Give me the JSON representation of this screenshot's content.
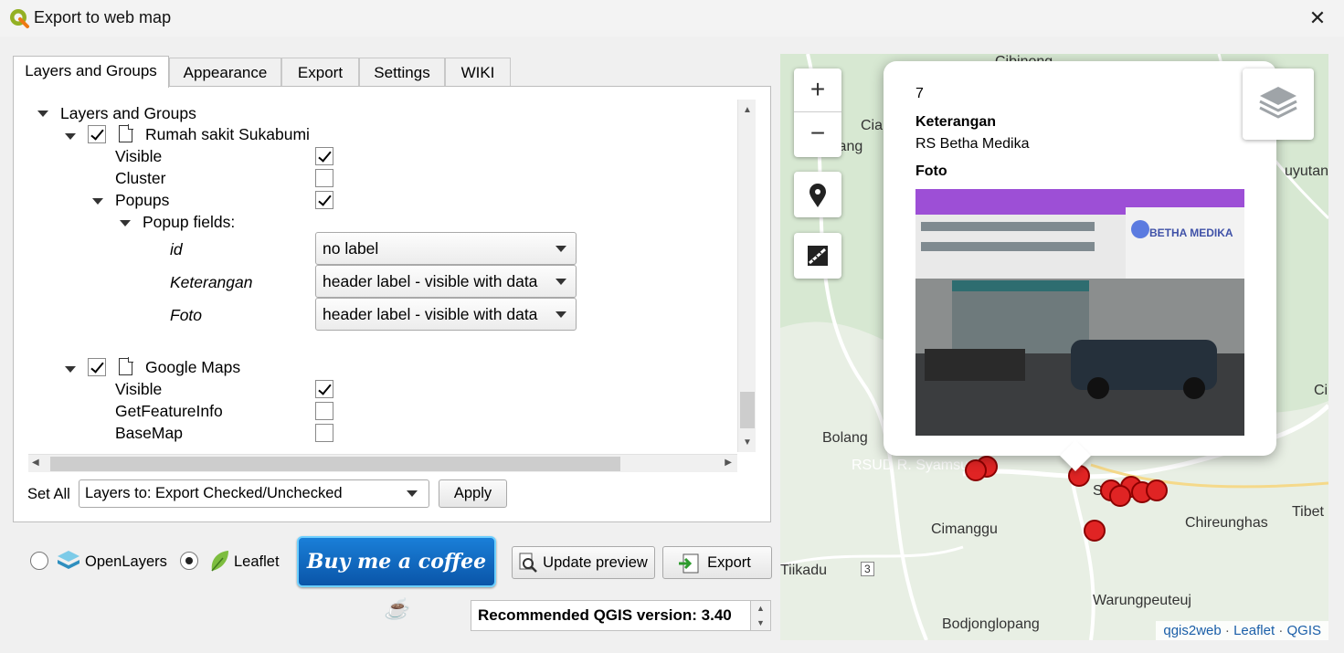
{
  "window": {
    "title": "Export to web map",
    "close_glyph": "✕"
  },
  "tabs": [
    {
      "label": "Layers and Groups",
      "active": true
    },
    {
      "label": "Appearance"
    },
    {
      "label": "Export"
    },
    {
      "label": "Settings"
    },
    {
      "label": "WIKI"
    }
  ],
  "tree": {
    "root_label": "Layers and Groups",
    "layer1": {
      "name": "Rumah sakit Sukabumi",
      "checked": true,
      "visible_label": "Visible",
      "cluster_label": "Cluster",
      "popups_label": "Popups",
      "popup_fields_label": "Popup fields:",
      "fields": [
        {
          "name": "id",
          "value": "no label"
        },
        {
          "name": "Keterangan",
          "value": "header label - visible with data"
        },
        {
          "name": "Foto",
          "value": "header label - visible with data"
        }
      ]
    },
    "layer2": {
      "name": "Google Maps",
      "checked": true,
      "visible_label": "Visible",
      "getfeatureinfo_label": "GetFeatureInfo",
      "basemap_label": "BaseMap"
    }
  },
  "set_all": {
    "label": "Set All",
    "combo_value": "Layers to: Export Checked/Unchecked",
    "apply_label": "Apply"
  },
  "renderer": {
    "openlayers_label": "OpenLayers",
    "leaflet_label": "Leaflet",
    "selected": "Leaflet"
  },
  "buttons": {
    "coffee_label": "Buy me a coffee ☕",
    "update_preview_label": "Update preview",
    "export_label": "Export"
  },
  "recommended": "Recommended QGIS version: 3.40",
  "map": {
    "zoom_in": "+",
    "zoom_out": "−",
    "labels": [
      "Cibinong",
      "Cia",
      "jang",
      "uyutan",
      "Bolang",
      "RSUD R. Syamsudin",
      "Cimanggu",
      "Chireunghas",
      "Tibet",
      "Tiikadu",
      "3",
      "Warungpeuteuj",
      "Bodjonglopang",
      "Ci",
      "S"
    ],
    "popup": {
      "id_value": "7",
      "field1_label": "Keterangan",
      "field1_value": "RS Betha Medika",
      "field2_label": "Foto",
      "photo_sign": "BETHA MEDIKA"
    },
    "attribution": [
      "qgis2web",
      "Leaflet",
      "QGIS"
    ]
  },
  "colors": {
    "poi": "#e02424",
    "coffee_button": "#0a6ed1",
    "link": "#1a5ea8"
  }
}
